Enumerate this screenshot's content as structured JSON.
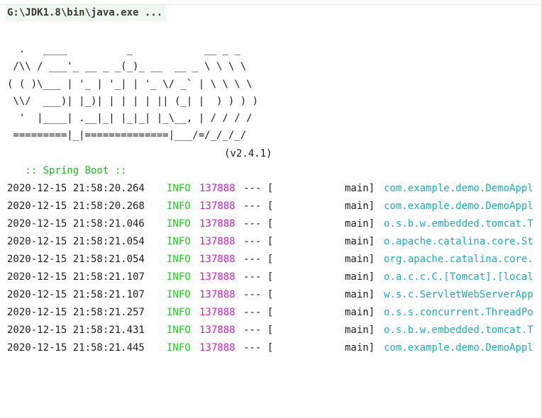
{
  "window": {
    "title": "G:\\JDK1.8\\bin\\java.exe ..."
  },
  "banner": {
    "ascii_lines": [
      "  .   ____          _            __ _ _",
      " /\\\\ / ___'_ __ _ _(_)_ __  __ _ \\ \\ \\ \\",
      "( ( )\\___ | '_ | '_| | '_ \\/ _` | \\ \\ \\ \\",
      " \\\\/  ___)| |_)| | | | | || (_| |  ) ) ) )",
      "  '  |____| .__|_| |_|_| |_\\__, | / / / /",
      " =========|_|==============|___/=/_/_/_/"
    ],
    "boot_label": " :: Spring Boot ::",
    "boot_version": "(v2.4.1)"
  },
  "colors": {
    "info_level": "#22cc22",
    "pid": "#cc22cc",
    "logger": "#22aabb",
    "boot_label": "#22bb22",
    "title_bg": "#eef8ee"
  },
  "log": {
    "rows": [
      {
        "timestamp": "2020-12-15 21:58:20.264",
        "level": "INFO",
        "pid": "137888",
        "sep": "--- [",
        "thread": "main]",
        "logger": "com.example.demo.DemoAppl"
      },
      {
        "timestamp": "2020-12-15 21:58:20.268",
        "level": "INFO",
        "pid": "137888",
        "sep": "--- [",
        "thread": "main]",
        "logger": "com.example.demo.DemoAppl"
      },
      {
        "timestamp": "2020-12-15 21:58:21.046",
        "level": "INFO",
        "pid": "137888",
        "sep": "--- [",
        "thread": "main]",
        "logger": "o.s.b.w.embedded.tomcat.T"
      },
      {
        "timestamp": "2020-12-15 21:58:21.054",
        "level": "INFO",
        "pid": "137888",
        "sep": "--- [",
        "thread": "main]",
        "logger": "o.apache.catalina.core.St"
      },
      {
        "timestamp": "2020-12-15 21:58:21.054",
        "level": "INFO",
        "pid": "137888",
        "sep": "--- [",
        "thread": "main]",
        "logger": "org.apache.catalina.core."
      },
      {
        "timestamp": "2020-12-15 21:58:21.107",
        "level": "INFO",
        "pid": "137888",
        "sep": "--- [",
        "thread": "main]",
        "logger": "o.a.c.c.C.[Tomcat].[local"
      },
      {
        "timestamp": "2020-12-15 21:58:21.107",
        "level": "INFO",
        "pid": "137888",
        "sep": "--- [",
        "thread": "main]",
        "logger": "w.s.c.ServletWebServerApp"
      },
      {
        "timestamp": "2020-12-15 21:58:21.257",
        "level": "INFO",
        "pid": "137888",
        "sep": "--- [",
        "thread": "main]",
        "logger": "o.s.s.concurrent.ThreadPo"
      },
      {
        "timestamp": "2020-12-15 21:58:21.431",
        "level": "INFO",
        "pid": "137888",
        "sep": "--- [",
        "thread": "main]",
        "logger": "o.s.b.w.embedded.tomcat.T"
      },
      {
        "timestamp": "2020-12-15 21:58:21.445",
        "level": "INFO",
        "pid": "137888",
        "sep": "--- [",
        "thread": "main]",
        "logger": "com.example.demo.DemoAppl"
      }
    ]
  }
}
